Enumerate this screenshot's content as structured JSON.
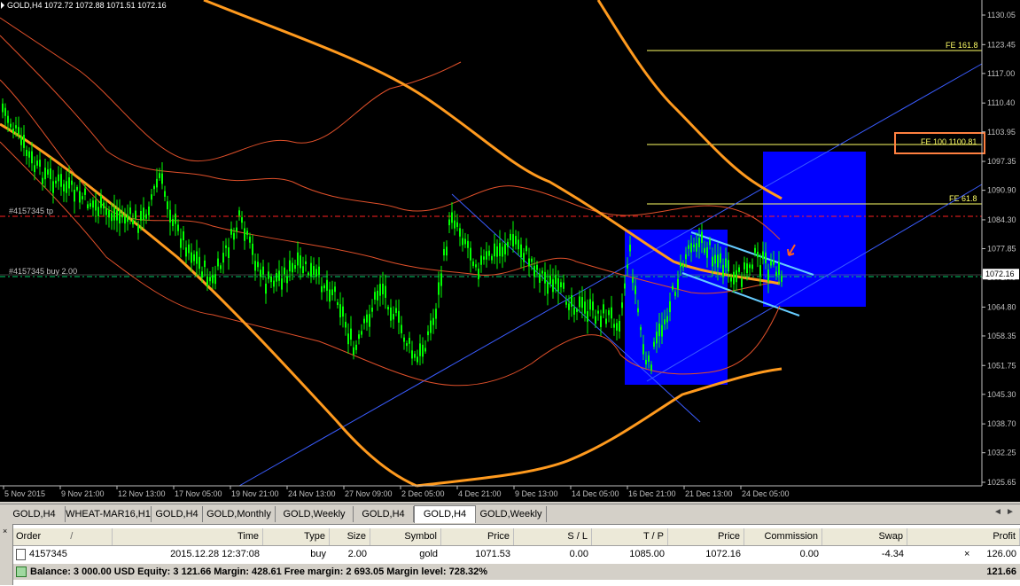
{
  "chart": {
    "header": {
      "symbol": "GOLD,H4",
      "open": "1072.72",
      "high": "1072.88",
      "low": "1071.51",
      "close": "1072.16"
    },
    "price_axis": [
      "1130.05",
      "1123.45",
      "1117.00",
      "1110.40",
      "1103.95",
      "1097.35",
      "1090.90",
      "1084.30",
      "1077.85",
      "1071.40",
      "1064.80",
      "1058.35",
      "1051.75",
      "1045.30",
      "1038.70",
      "1032.25",
      "1025.65"
    ],
    "current_price": "1072.16",
    "time_axis": [
      "5 Nov 2015",
      "9 Nov 21:00",
      "12 Nov 13:00",
      "17 Nov 05:00",
      "19 Nov 21:00",
      "24 Nov 13:00",
      "27 Nov 09:00",
      "2 Dec 05:00",
      "4 Dec 21:00",
      "9 Dec 13:00",
      "14 Dec 05:00",
      "16 Dec 21:00",
      "21 Dec 13:00",
      "24 Dec 05:00"
    ],
    "labels": {
      "tp": "#4157345 tp",
      "buy": "#4157345 buy 2.00",
      "fe161": "FE 161.8",
      "fe100": "FE 100 1100.81",
      "fe61": "FE 61.8"
    },
    "colors": {
      "background": "#000000",
      "candles": "#00ff00",
      "ma_thick": "#ff9a1e",
      "bands": "#e0502a",
      "trendline": "#3a5cff",
      "fibo": "#ffff66",
      "highlight_box": "#0000ff",
      "channel": "#66ccff",
      "tp_line": "#ff2020",
      "entry_line": "#00cc66"
    }
  },
  "tabs": [
    {
      "label": "GOLD,H4",
      "active": false
    },
    {
      "label": "WHEAT-MAR16,H1",
      "active": false
    },
    {
      "label": "GOLD,H4",
      "active": false
    },
    {
      "label": "GOLD,Monthly",
      "active": false
    },
    {
      "label": "GOLD,Weekly",
      "active": false
    },
    {
      "label": "GOLD,H4",
      "active": false
    },
    {
      "label": "GOLD,H4",
      "active": true
    },
    {
      "label": "GOLD,Weekly",
      "active": false
    }
  ],
  "terminal": {
    "headers": {
      "order": "Order",
      "sort": "/",
      "time": "Time",
      "type": "Type",
      "size": "Size",
      "symbol": "Symbol",
      "price": "Price",
      "sl": "S / L",
      "tp": "T / P",
      "price2": "Price",
      "commission": "Commission",
      "swap": "Swap",
      "profit": "Profit"
    },
    "order_row": {
      "order": "4157345",
      "time": "2015.12.28 12:37:08",
      "type": "buy",
      "size": "2.00",
      "symbol": "gold",
      "price": "1071.53",
      "sl": "0.00",
      "tp": "1085.00",
      "price2": "1072.16",
      "commission": "0.00",
      "swap": "-4.34",
      "profit": "126.00"
    },
    "balance_text": "Balance: 3 000.00 USD  Equity: 3 121.66  Margin: 428.61  Free margin: 2 693.05  Margin level: 728.32%",
    "balance_profit": "121.66",
    "close_glyph": "×"
  }
}
